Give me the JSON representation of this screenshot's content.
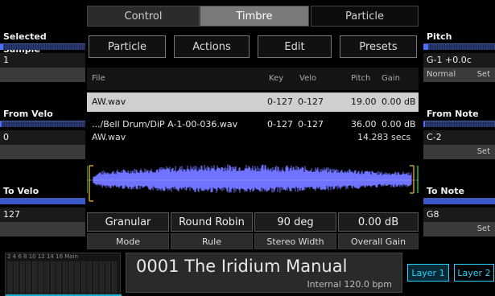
{
  "tabs": {
    "control": "Control",
    "timbre": "Timbre",
    "particle": "Particle"
  },
  "left_panel": {
    "selected_sample_label": "Selected Sample",
    "selected_sample_value": "1",
    "from_velo_label": "From Velo",
    "from_velo_value": "0",
    "to_velo_label": "To Velo",
    "to_velo_value": "127"
  },
  "right_panel": {
    "pitch_label": "Pitch",
    "pitch_value": "G-1 +0.0c",
    "pitch_mode": "Normal",
    "pitch_set": "Set",
    "from_note_label": "From Note",
    "from_note_value": "C-2",
    "from_note_set": "Set",
    "to_note_label": "To Note",
    "to_note_value": "G8",
    "to_note_set": "Set"
  },
  "buttons": {
    "particle": "Particle",
    "actions": "Actions",
    "edit": "Edit",
    "presets": "Presets"
  },
  "file_table": {
    "headers": {
      "file": "File",
      "key": "Key",
      "velo": "Velo",
      "pitch": "Pitch",
      "gain": "Gain"
    },
    "rows": [
      {
        "file": "AW.wav",
        "key": "0-127",
        "velo": "0-127",
        "pitch": "19.00",
        "gain": "0.00 dB"
      },
      {
        "file": ".../Bell Drum/DiP A-1-00-036.wav",
        "key": "0-127",
        "velo": "0-127",
        "pitch": "36.00",
        "gain": "0.00 dB"
      }
    ]
  },
  "waveform": {
    "name": "AW.wav",
    "duration": "14.283 secs",
    "color": "#6f73ff"
  },
  "params": {
    "mode_value": "Granular",
    "mode_label": "Mode",
    "rule_value": "Round Robin",
    "rule_label": "Rule",
    "width_value": "90 deg",
    "width_label": "Stereo Width",
    "gain_value": "0.00 dB",
    "gain_label": "Overall Gain"
  },
  "mixer": {
    "scale": "2   4   6   8  10  12  14  16 Main"
  },
  "preset": {
    "name": "0001 The Iridium Manual",
    "status": "Internal 120.0 bpm"
  },
  "layers": {
    "layer1": "Layer 1",
    "layer2": "Layer 2"
  }
}
